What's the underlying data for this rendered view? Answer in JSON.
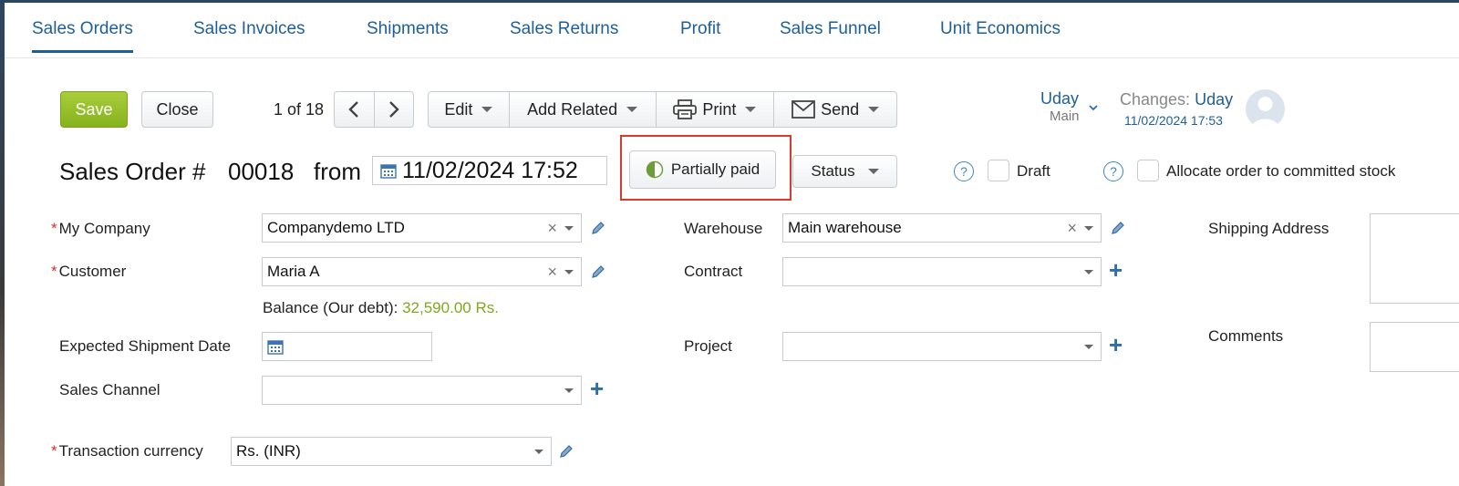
{
  "tabs": [
    {
      "label": "Sales Orders",
      "active": true
    },
    {
      "label": "Sales Invoices"
    },
    {
      "label": "Shipments"
    },
    {
      "label": "Sales Returns"
    },
    {
      "label": "Profit"
    },
    {
      "label": "Sales Funnel"
    },
    {
      "label": "Unit Economics"
    }
  ],
  "toolbar": {
    "save_label": "Save",
    "close_label": "Close",
    "pager": "1 of 18",
    "edit_label": "Edit",
    "add_related_label": "Add Related",
    "print_label": "Print",
    "send_label": "Send"
  },
  "user": {
    "name": "Uday",
    "role": "Main",
    "changes_prefix": "Changes:",
    "changes_user": "Uday",
    "changes_time": "11/02/2024 17:53"
  },
  "header": {
    "title_prefix": "Sales Order #",
    "number": "00018",
    "from_label": "from",
    "datetime": "11/02/2024 17:52",
    "payment_status": "Partially paid",
    "status_label": "Status",
    "draft_label": "Draft",
    "allocate_label": "Allocate order to committed stock"
  },
  "form": {
    "my_company_label": "My Company",
    "my_company_value": "Companydemo LTD",
    "customer_label": "Customer",
    "customer_value": "Maria A",
    "balance_label": "Balance (Our debt):",
    "balance_value": "32,590.00 Rs.",
    "expected_shipment_label": "Expected Shipment Date",
    "sales_channel_label": "Sales Channel",
    "currency_label": "Transaction currency",
    "currency_value": "Rs. (INR)",
    "warehouse_label": "Warehouse",
    "warehouse_value": "Main warehouse",
    "contract_label": "Contract",
    "project_label": "Project",
    "shipping_address_label": "Shipping Address",
    "comments_label": "Comments"
  },
  "colors": {
    "accent": "#1e5f99",
    "save": "#8fbb24",
    "balance": "#7fa81a",
    "highlight": "#d93a2b"
  }
}
